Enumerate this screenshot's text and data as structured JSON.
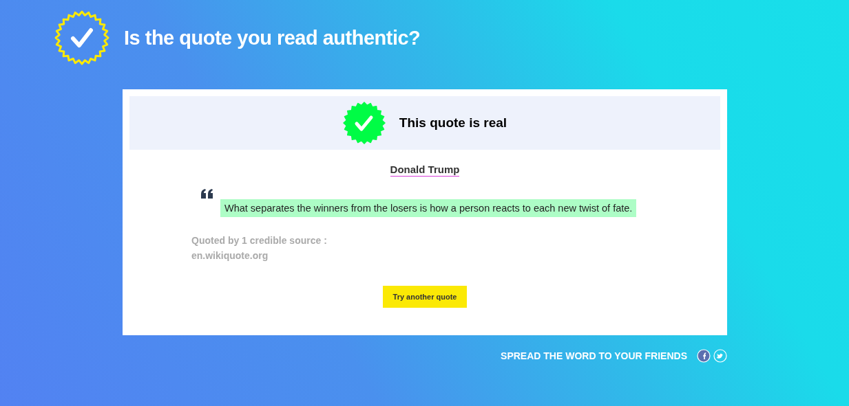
{
  "header": {
    "title": "Is the quote you read authentic?"
  },
  "result": {
    "verdict": "This quote is real",
    "verified": true
  },
  "quote": {
    "author": "Donald Trump",
    "text": "What separates the winners from the losers is how a person reacts to each new twist of fate."
  },
  "sources": {
    "label": "Quoted by 1 credible source :",
    "items": [
      "en.wikiquote.org"
    ]
  },
  "button": "Try another quote",
  "footer": {
    "text": "SPREAD THE WORD TO YOUR FRIENDS",
    "social": [
      {
        "kind": "facebook"
      },
      {
        "kind": "twitter"
      }
    ]
  }
}
